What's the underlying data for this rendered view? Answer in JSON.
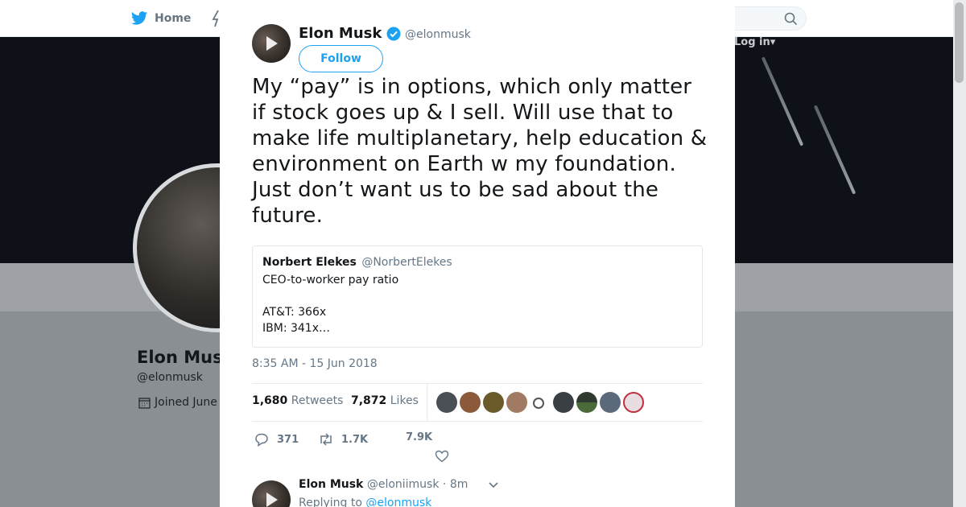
{
  "nav": {
    "home_label": "Home",
    "login_label": "Log in"
  },
  "profile": {
    "name": "Elon Musk",
    "handle": "@elonmusk",
    "joined": "Joined June"
  },
  "tweet": {
    "author_name": "Elon Musk",
    "author_handle": "@elonmusk",
    "follow_label": "Follow",
    "text": "My “pay” is in options, which only matter if stock goes up & I sell. Will use that to make life multiplanetary, help education & environment on Earth w my foundation. Just don’t want us to be sad about the future.",
    "quote": {
      "name": "Norbert Elekes",
      "handle": "@NorbertElekes",
      "text": "CEO-to-worker pay ratio\n\nAT&T: 366x\nIBM: 341x…"
    },
    "timestamp": "8:35 AM - 15 Jun 2018",
    "retweets_count": "1,680",
    "retweets_label": "Retweets",
    "likes_count": "7,872",
    "likes_label": "Likes",
    "actions": {
      "reply_count": "371",
      "retweet_count": "1.7K",
      "like_count": "7.9K"
    }
  },
  "reply": {
    "name": "Elon Musk",
    "handle": "@eloniimusk",
    "time": "· 8m",
    "replying_prefix": "Replying to",
    "replying_to": "@elonmusk"
  },
  "colors": {
    "accent": "#1da1f2",
    "text": "#14171a",
    "muted": "#657786"
  }
}
